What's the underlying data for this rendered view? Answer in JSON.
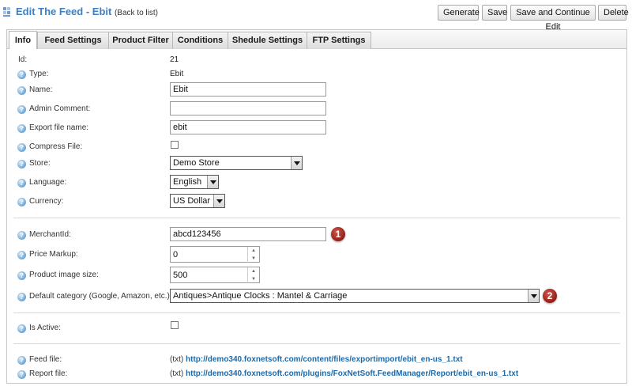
{
  "header": {
    "title": "Edit The Feed - Ebit",
    "back_link": "(Back to list)",
    "buttons": {
      "generate": "Generate",
      "save": "Save",
      "save_continue": "Save and Continue Edit",
      "delete": "Delete"
    }
  },
  "tabs": [
    "Info",
    "Feed Settings",
    "Product Filter",
    "Conditions",
    "Shedule Settings",
    "FTP Settings"
  ],
  "active_tab": "Info",
  "help_glyph": "?",
  "fields": {
    "id": {
      "label": "Id:",
      "value": "21"
    },
    "type": {
      "label": "Type:",
      "value": "Ebit"
    },
    "name": {
      "label": "Name:",
      "value": "Ebit"
    },
    "admin_comment": {
      "label": "Admin Comment:",
      "value": ""
    },
    "export_file_name": {
      "label": "Export file name:",
      "value": "ebit"
    },
    "compress_file": {
      "label": "Compress File:",
      "checked": false
    },
    "store": {
      "label": "Store:",
      "value": "Demo Store"
    },
    "language": {
      "label": "Language:",
      "value": "English"
    },
    "currency": {
      "label": "Currency:",
      "value": "US Dollar"
    },
    "merchant_id": {
      "label": "MerchantId:",
      "value": "abcd123456"
    },
    "price_markup": {
      "label": "Price Markup:",
      "value": "0"
    },
    "product_image_size": {
      "label": "Product image size:",
      "value": "500"
    },
    "default_category": {
      "label": "Default category (Google, Amazon, etc.):",
      "value": "Antiques>Antique Clocks : Mantel & Carriage"
    },
    "is_active": {
      "label": "Is Active:",
      "checked": false
    },
    "feed_file": {
      "label": "Feed file:",
      "prefix": "(txt)",
      "url": "http://demo340.foxnetsoft.com/content/files/exportimport/ebit_en-us_1.txt"
    },
    "report_file": {
      "label": "Report file:",
      "prefix": "(txt)",
      "url": "http://demo340.foxnetsoft.com/plugins/FoxNetSoft.FeedManager/Report/ebit_en-us_1.txt"
    }
  },
  "markers": {
    "one": "1",
    "two": "2"
  },
  "colors": {
    "title": "#3d7fc1",
    "link": "#1e6aa8",
    "marker": "#8c1c14"
  }
}
